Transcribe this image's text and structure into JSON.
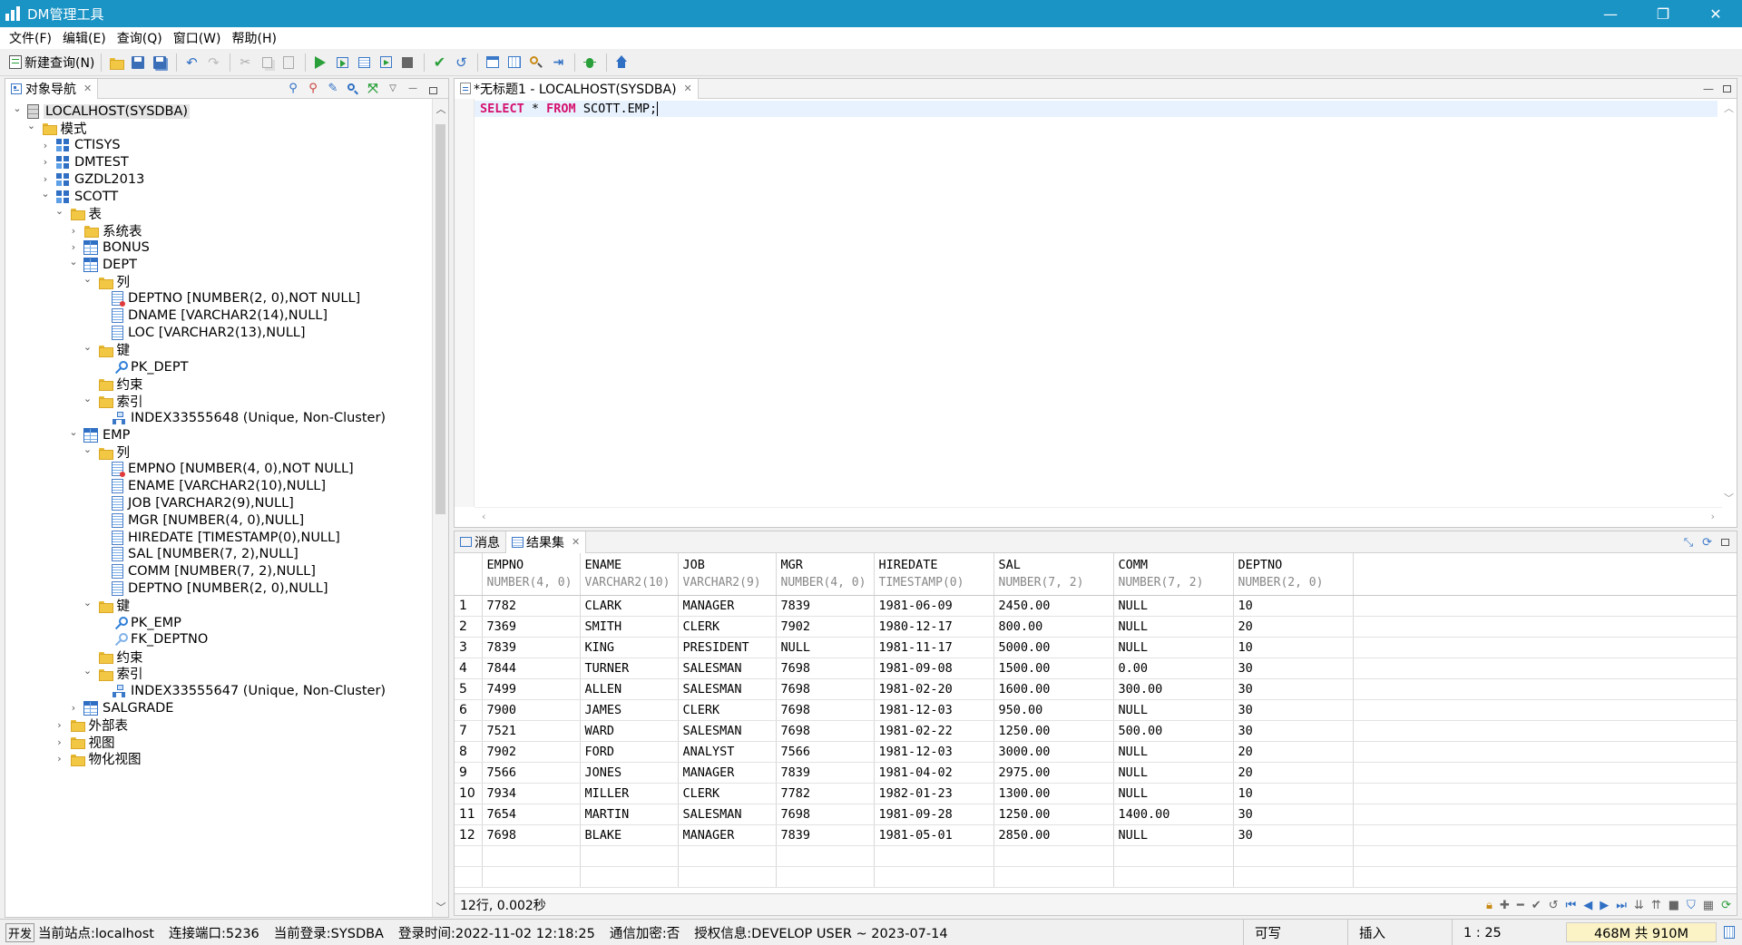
{
  "window": {
    "title": "DM管理工具",
    "controls": {
      "minimize": "—",
      "restore": "❐",
      "close": "✕"
    }
  },
  "menu": [
    "文件(F)",
    "编辑(E)",
    "查询(Q)",
    "窗口(W)",
    "帮助(H)"
  ],
  "toolbar": {
    "new_query": "新建查询(N)"
  },
  "navigator": {
    "tab_label": "对象导航",
    "tree": [
      {
        "label": "LOCALHOST(SYSDBA)",
        "level": 0,
        "icon": "server-icon",
        "expanded": true,
        "selected": true
      },
      {
        "label": "模式",
        "level": 1,
        "icon": "folder-icon",
        "expanded": true
      },
      {
        "label": "CTISYS",
        "level": 2,
        "icon": "schema-icon",
        "expanded": false
      },
      {
        "label": "DMTEST",
        "level": 2,
        "icon": "schema-icon",
        "expanded": false
      },
      {
        "label": "GZDL2013",
        "level": 2,
        "icon": "schema-icon",
        "expanded": false
      },
      {
        "label": "SCOTT",
        "level": 2,
        "icon": "schema-icon",
        "expanded": true
      },
      {
        "label": "表",
        "level": 3,
        "icon": "folder-icon",
        "expanded": true
      },
      {
        "label": "系统表",
        "level": 4,
        "icon": "folder-icon",
        "expanded": false
      },
      {
        "label": "BONUS",
        "level": 4,
        "icon": "table-icon",
        "expanded": false
      },
      {
        "label": "DEPT",
        "level": 4,
        "icon": "table-icon",
        "expanded": true
      },
      {
        "label": "列",
        "level": 5,
        "icon": "folder-icon",
        "expanded": true
      },
      {
        "label": "DEPTNO [NUMBER(2, 0),NOT NULL]",
        "level": 6,
        "icon": "column-notnull-icon"
      },
      {
        "label": "DNAME [VARCHAR2(14),NULL]",
        "level": 6,
        "icon": "column-icon"
      },
      {
        "label": "LOC [VARCHAR2(13),NULL]",
        "level": 6,
        "icon": "column-icon"
      },
      {
        "label": "键",
        "level": 5,
        "icon": "folder-icon",
        "expanded": true
      },
      {
        "label": "PK_DEPT",
        "level": 6,
        "icon": "primary-key-icon"
      },
      {
        "label": "约束",
        "level": 5,
        "icon": "folder-icon"
      },
      {
        "label": "索引",
        "level": 5,
        "icon": "folder-icon",
        "expanded": true
      },
      {
        "label": "INDEX33555648 (Unique, Non-Cluster)",
        "level": 6,
        "icon": "index-icon"
      },
      {
        "label": "EMP",
        "level": 4,
        "icon": "table-icon",
        "expanded": true
      },
      {
        "label": "列",
        "level": 5,
        "icon": "folder-icon",
        "expanded": true
      },
      {
        "label": "EMPNO [NUMBER(4, 0),NOT NULL]",
        "level": 6,
        "icon": "column-notnull-icon"
      },
      {
        "label": "ENAME [VARCHAR2(10),NULL]",
        "level": 6,
        "icon": "column-icon"
      },
      {
        "label": "JOB [VARCHAR2(9),NULL]",
        "level": 6,
        "icon": "column-icon"
      },
      {
        "label": "MGR [NUMBER(4, 0),NULL]",
        "level": 6,
        "icon": "column-icon"
      },
      {
        "label": "HIREDATE [TIMESTAMP(0),NULL]",
        "level": 6,
        "icon": "column-icon"
      },
      {
        "label": "SAL [NUMBER(7, 2),NULL]",
        "level": 6,
        "icon": "column-icon"
      },
      {
        "label": "COMM [NUMBER(7, 2),NULL]",
        "level": 6,
        "icon": "column-icon"
      },
      {
        "label": "DEPTNO [NUMBER(2, 0),NULL]",
        "level": 6,
        "icon": "column-icon"
      },
      {
        "label": "键",
        "level": 5,
        "icon": "folder-icon",
        "expanded": true
      },
      {
        "label": "PK_EMP",
        "level": 6,
        "icon": "primary-key-icon"
      },
      {
        "label": "FK_DEPTNO",
        "level": 6,
        "icon": "foreign-key-icon"
      },
      {
        "label": "约束",
        "level": 5,
        "icon": "folder-icon"
      },
      {
        "label": "索引",
        "level": 5,
        "icon": "folder-icon",
        "expanded": true
      },
      {
        "label": "INDEX33555647 (Unique, Non-Cluster)",
        "level": 6,
        "icon": "index-icon"
      },
      {
        "label": "SALGRADE",
        "level": 4,
        "icon": "table-icon",
        "expanded": false
      },
      {
        "label": "外部表",
        "level": 3,
        "icon": "folder-icon",
        "expanded": false
      },
      {
        "label": "视图",
        "level": 3,
        "icon": "folder-icon",
        "expanded": false
      },
      {
        "label": "物化视图",
        "level": 3,
        "icon": "folder-icon",
        "expanded": false
      }
    ]
  },
  "editor": {
    "tab_label": "*无标题1 - LOCALHOST(SYSDBA)",
    "sql": {
      "kw1": "SELECT",
      "star": " * ",
      "kw2": "FROM",
      "rest": " SCOTT.EMP;"
    }
  },
  "results": {
    "tabs": {
      "messages": "消息",
      "resultset": "结果集"
    },
    "columns": [
      {
        "name": "EMPNO",
        "type": "NUMBER(4, 0)"
      },
      {
        "name": "ENAME",
        "type": "VARCHAR2(10)"
      },
      {
        "name": "JOB",
        "type": "VARCHAR2(9)"
      },
      {
        "name": "MGR",
        "type": "NUMBER(4, 0)"
      },
      {
        "name": "HIREDATE",
        "type": "TIMESTAMP(0)"
      },
      {
        "name": "SAL",
        "type": "NUMBER(7, 2)"
      },
      {
        "name": "COMM",
        "type": "NUMBER(7, 2)"
      },
      {
        "name": "DEPTNO",
        "type": "NUMBER(2, 0)"
      }
    ],
    "rows": [
      [
        "1",
        "7782",
        "CLARK",
        "MANAGER",
        "7839",
        "1981-06-09",
        "2450.00",
        "NULL",
        "10"
      ],
      [
        "2",
        "7369",
        "SMITH",
        "CLERK",
        "7902",
        "1980-12-17",
        "800.00",
        "NULL",
        "20"
      ],
      [
        "3",
        "7839",
        "KING",
        "PRESIDENT",
        "NULL",
        "1981-11-17",
        "5000.00",
        "NULL",
        "10"
      ],
      [
        "4",
        "7844",
        "TURNER",
        "SALESMAN",
        "7698",
        "1981-09-08",
        "1500.00",
        "0.00",
        "30"
      ],
      [
        "5",
        "7499",
        "ALLEN",
        "SALESMAN",
        "7698",
        "1981-02-20",
        "1600.00",
        "300.00",
        "30"
      ],
      [
        "6",
        "7900",
        "JAMES",
        "CLERK",
        "7698",
        "1981-12-03",
        "950.00",
        "NULL",
        "30"
      ],
      [
        "7",
        "7521",
        "WARD",
        "SALESMAN",
        "7698",
        "1981-02-22",
        "1250.00",
        "500.00",
        "30"
      ],
      [
        "8",
        "7902",
        "FORD",
        "ANALYST",
        "7566",
        "1981-12-03",
        "3000.00",
        "NULL",
        "20"
      ],
      [
        "9",
        "7566",
        "JONES",
        "MANAGER",
        "7839",
        "1981-04-02",
        "2975.00",
        "NULL",
        "20"
      ],
      [
        "10",
        "7934",
        "MILLER",
        "CLERK",
        "7782",
        "1982-01-23",
        "1300.00",
        "NULL",
        "10"
      ],
      [
        "11",
        "7654",
        "MARTIN",
        "SALESMAN",
        "7698",
        "1981-09-28",
        "1250.00",
        "1400.00",
        "30"
      ],
      [
        "12",
        "7698",
        "BLAKE",
        "MANAGER",
        "7839",
        "1981-05-01",
        "2850.00",
        "NULL",
        "30"
      ]
    ],
    "summary": "12行, 0.002秒"
  },
  "statusbar": {
    "mode": "开发",
    "site": "当前站点:localhost",
    "port": "连接端口:5236",
    "login": "当前登录:SYSDBA",
    "login_time": "登录时间:2022-11-02 12:18:25",
    "encryption": "通信加密:否",
    "license": "授权信息:DEVELOP USER ~ 2023-07-14",
    "writable": "可写",
    "insert_mode": "插入",
    "position": "1 : 25",
    "memory": "468M 共 910M"
  },
  "colors": {
    "titlebar": "#1a93c5",
    "keyword": "#d6116f",
    "current_line": "#e8f2fe",
    "memory_bg": "#fbf3c6"
  }
}
